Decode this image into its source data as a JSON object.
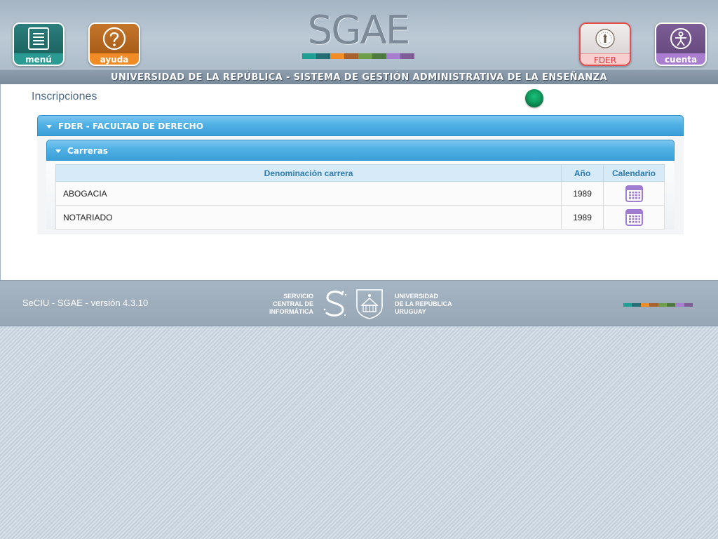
{
  "header": {
    "logo_text": "SGAE",
    "banner": "UNIVERSIDAD DE LA REPÚBLICA - SISTEMA DE GESTIÓN ADMINISTRATIVA DE LA ENSEÑANZA",
    "buttons": {
      "menu": "menú",
      "ayuda": "ayuda",
      "fder": "FDER",
      "cuenta": "cuenta"
    },
    "icons": {
      "menu": "document-list-icon",
      "ayuda": "question-mark-icon",
      "fder": "seal-icon",
      "cuenta": "person-icon"
    },
    "logo_colors": [
      "#1f9e93",
      "#246d74",
      "#f08b25",
      "#a8612c",
      "#6e9e4c",
      "#4d7a3e",
      "#a77dcd",
      "#7c5d95"
    ]
  },
  "page": {
    "title": "Inscripciones"
  },
  "facultad_panel": {
    "title": "FDER - FACULTAD DE DERECHO"
  },
  "carreras_panel": {
    "title": "Carreras",
    "columns": [
      "Denominación carrera",
      "Año",
      "Calendario"
    ],
    "rows": [
      {
        "name": "ABOGACIA",
        "year": "1989",
        "calendar_icon": "calendar-icon"
      },
      {
        "name": "NOTARIADO",
        "year": "1989",
        "calendar_icon": "calendar-icon"
      }
    ]
  },
  "footer": {
    "version": "SeCIU - SGAE - versión 4.3.10",
    "seciu_lines": [
      "SERVICIO",
      "CENTRAL DE",
      "INFORMÁTICA"
    ],
    "udelar_lines": [
      "UNIVERSIDAD",
      "DE LA REPÚBLICA",
      "URUGUAY"
    ]
  },
  "colors": {
    "accent_blue": "#4fb0e4",
    "status_green": "#0f9a5c",
    "calendar_purple": "#9f7ccf"
  }
}
